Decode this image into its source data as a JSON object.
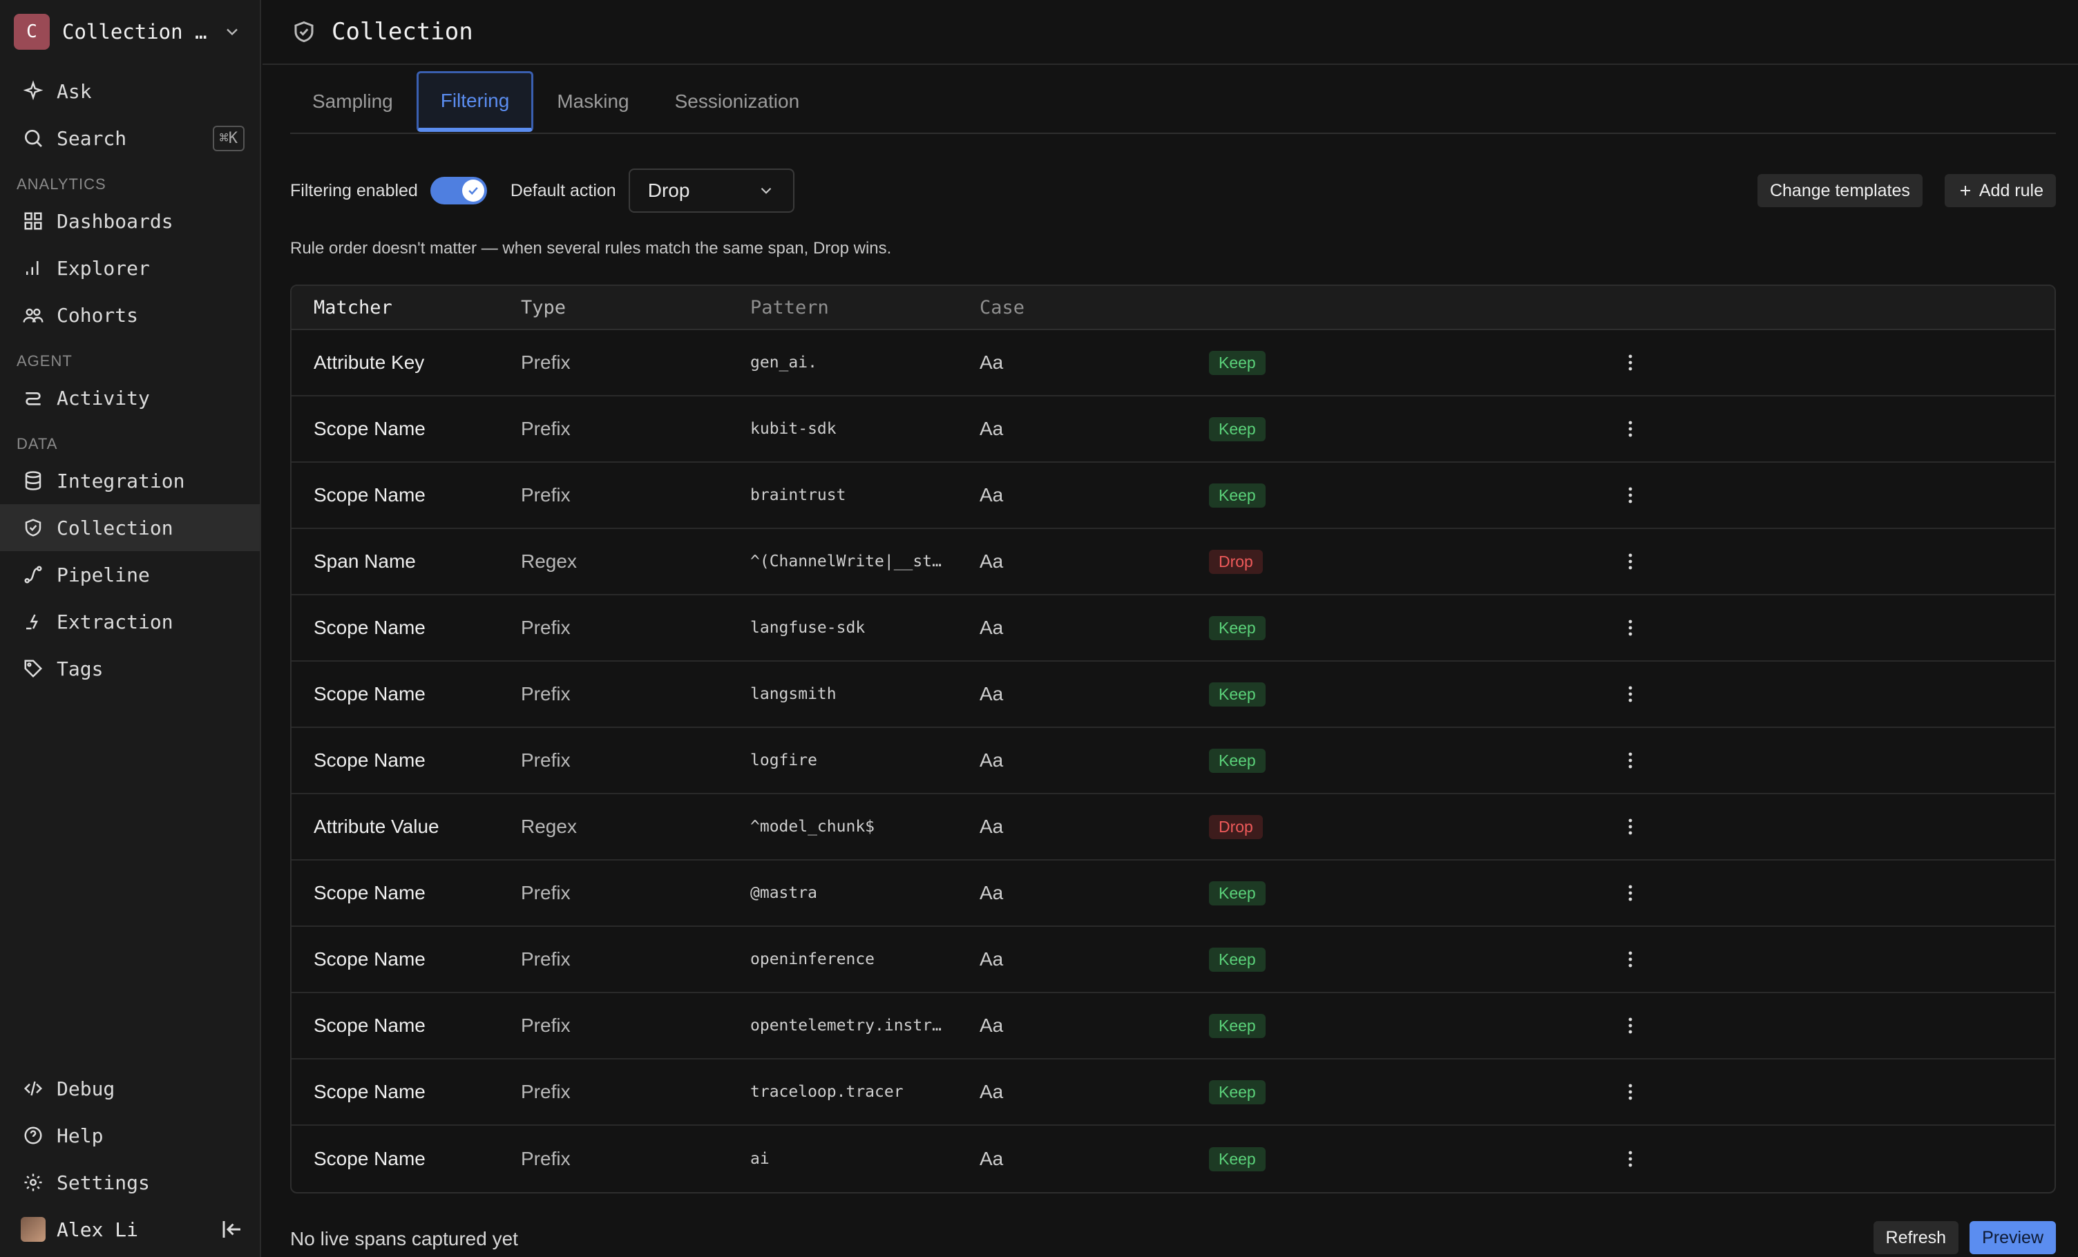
{
  "workspace": {
    "initial": "C",
    "name": "Collection t..."
  },
  "sidebar": {
    "ask": "Ask",
    "search": "Search",
    "search_kbd": "⌘K",
    "analytics_label": "ANALYTICS",
    "dashboards": "Dashboards",
    "explorer": "Explorer",
    "cohorts": "Cohorts",
    "agent_label": "AGENT",
    "activity": "Activity",
    "data_label": "DATA",
    "integration": "Integration",
    "collection": "Collection",
    "pipeline": "Pipeline",
    "extraction": "Extraction",
    "tags": "Tags",
    "debug": "Debug",
    "help": "Help",
    "settings": "Settings",
    "user": "Alex Li"
  },
  "header": {
    "title": "Collection"
  },
  "tabs": [
    "Sampling",
    "Filtering",
    "Masking",
    "Sessionization"
  ],
  "toolbar": {
    "filtering_enabled_label": "Filtering enabled",
    "default_action_label": "Default action",
    "default_action_value": "Drop",
    "change_templates": "Change templates",
    "add_rule": "Add rule"
  },
  "note": "Rule order doesn't matter — when several rules match the same span, Drop wins.",
  "table": {
    "headers": [
      "Matcher",
      "Type",
      "Pattern",
      "Case"
    ],
    "rows": [
      {
        "matcher": "Attribute Key",
        "type": "Prefix",
        "pattern": "gen_ai.",
        "case": "Aa",
        "action": "Keep"
      },
      {
        "matcher": "Scope Name",
        "type": "Prefix",
        "pattern": "kubit-sdk",
        "case": "Aa",
        "action": "Keep"
      },
      {
        "matcher": "Scope Name",
        "type": "Prefix",
        "pattern": "braintrust",
        "case": "Aa",
        "action": "Keep"
      },
      {
        "matcher": "Span Name",
        "type": "Regex",
        "pattern": "^(ChannelWrite|__st…",
        "case": "Aa",
        "action": "Drop"
      },
      {
        "matcher": "Scope Name",
        "type": "Prefix",
        "pattern": "langfuse-sdk",
        "case": "Aa",
        "action": "Keep"
      },
      {
        "matcher": "Scope Name",
        "type": "Prefix",
        "pattern": "langsmith",
        "case": "Aa",
        "action": "Keep"
      },
      {
        "matcher": "Scope Name",
        "type": "Prefix",
        "pattern": "logfire",
        "case": "Aa",
        "action": "Keep"
      },
      {
        "matcher": "Attribute Value",
        "type": "Regex",
        "pattern": "^model_chunk$",
        "case": "Aa",
        "action": "Drop"
      },
      {
        "matcher": "Scope Name",
        "type": "Prefix",
        "pattern": "@mastra",
        "case": "Aa",
        "action": "Keep"
      },
      {
        "matcher": "Scope Name",
        "type": "Prefix",
        "pattern": "openinference",
        "case": "Aa",
        "action": "Keep"
      },
      {
        "matcher": "Scope Name",
        "type": "Prefix",
        "pattern": "opentelemetry.instr…",
        "case": "Aa",
        "action": "Keep"
      },
      {
        "matcher": "Scope Name",
        "type": "Prefix",
        "pattern": "traceloop.tracer",
        "case": "Aa",
        "action": "Keep"
      },
      {
        "matcher": "Scope Name",
        "type": "Prefix",
        "pattern": "ai",
        "case": "Aa",
        "action": "Keep"
      }
    ]
  },
  "footer": {
    "status": "No live spans captured yet",
    "refresh": "Refresh",
    "preview": "Preview"
  }
}
